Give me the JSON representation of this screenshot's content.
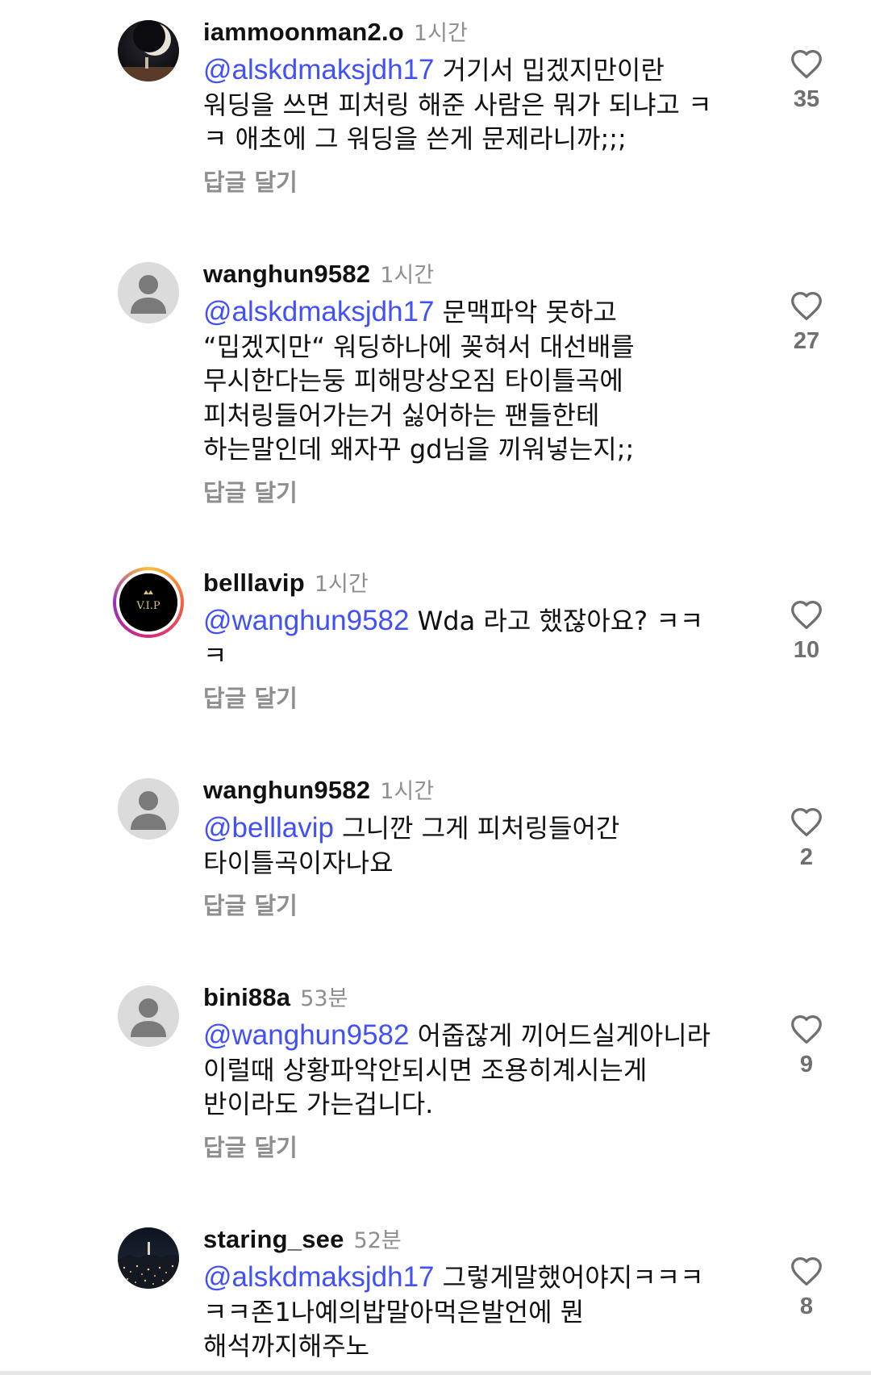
{
  "comments": [
    {
      "username": "iammoonman2.o",
      "time": "1시간",
      "mention": "@alskdmaksjdh17",
      "lines": [
        "거기서 밉겠지만이란",
        "워딩을 쓰면 피처링 해준 사람은 뭐가 되냐고 ㅋ",
        "ㅋ 애초에 그 워딩을 쓴게 문제라니까;;;"
      ],
      "reply_label": "답글 달기",
      "likes": "35"
    },
    {
      "username": "wanghun9582",
      "time": "1시간",
      "mention": "@alskdmaksjdh17",
      "lines": [
        "문맥파악 못하고",
        "“밉겠지만“ 워딩하나에 꽂혀서 대선배를",
        "무시한다는둥 피해망상오짐 타이틀곡에",
        "피처링들어가는거 싫어하는 팬들한테",
        "하는말인데 왜자꾸 gd님을 끼워넣는지;;"
      ],
      "reply_label": "답글 달기",
      "likes": "27"
    },
    {
      "username": "belllavip",
      "time": "1시간",
      "mention": "@wanghun9582",
      "lines": [
        "Wda 라고 했잖아요? ㅋㅋ",
        "ㅋ"
      ],
      "reply_label": "답글 달기",
      "likes": "10"
    },
    {
      "username": "wanghun9582",
      "time": "1시간",
      "mention": "@belllavip",
      "lines": [
        "그니깐 그게 피처링들어간",
        "타이틀곡이자나요"
      ],
      "reply_label": "답글 달기",
      "likes": "2"
    },
    {
      "username": "bini88a",
      "time": "53분",
      "mention": "@wanghun9582",
      "lines": [
        "어줍잖게 끼어드실게아니라",
        "이럴때 상황파악안되시면 조용히계시는게",
        "반이라도 가는겁니다."
      ],
      "reply_label": "답글 달기",
      "likes": "9"
    },
    {
      "username": "staring_see",
      "time": "52분",
      "mention": "@alskdmaksjdh17",
      "lines": [
        "그렇게말했어야지ㅋㅋㅋ",
        "ㅋㅋ존1나예의밥말아먹은발언에 뭔",
        "해석까지해주노"
      ],
      "reply_label": "",
      "likes": "8"
    }
  ],
  "colors": {
    "mention": "#4150f7",
    "secondary_text": "#8e8e8e",
    "like_count": "#6f6f6f"
  },
  "icons": {
    "like": "heart-outline-icon",
    "default_avatar": "default-person-icon"
  }
}
